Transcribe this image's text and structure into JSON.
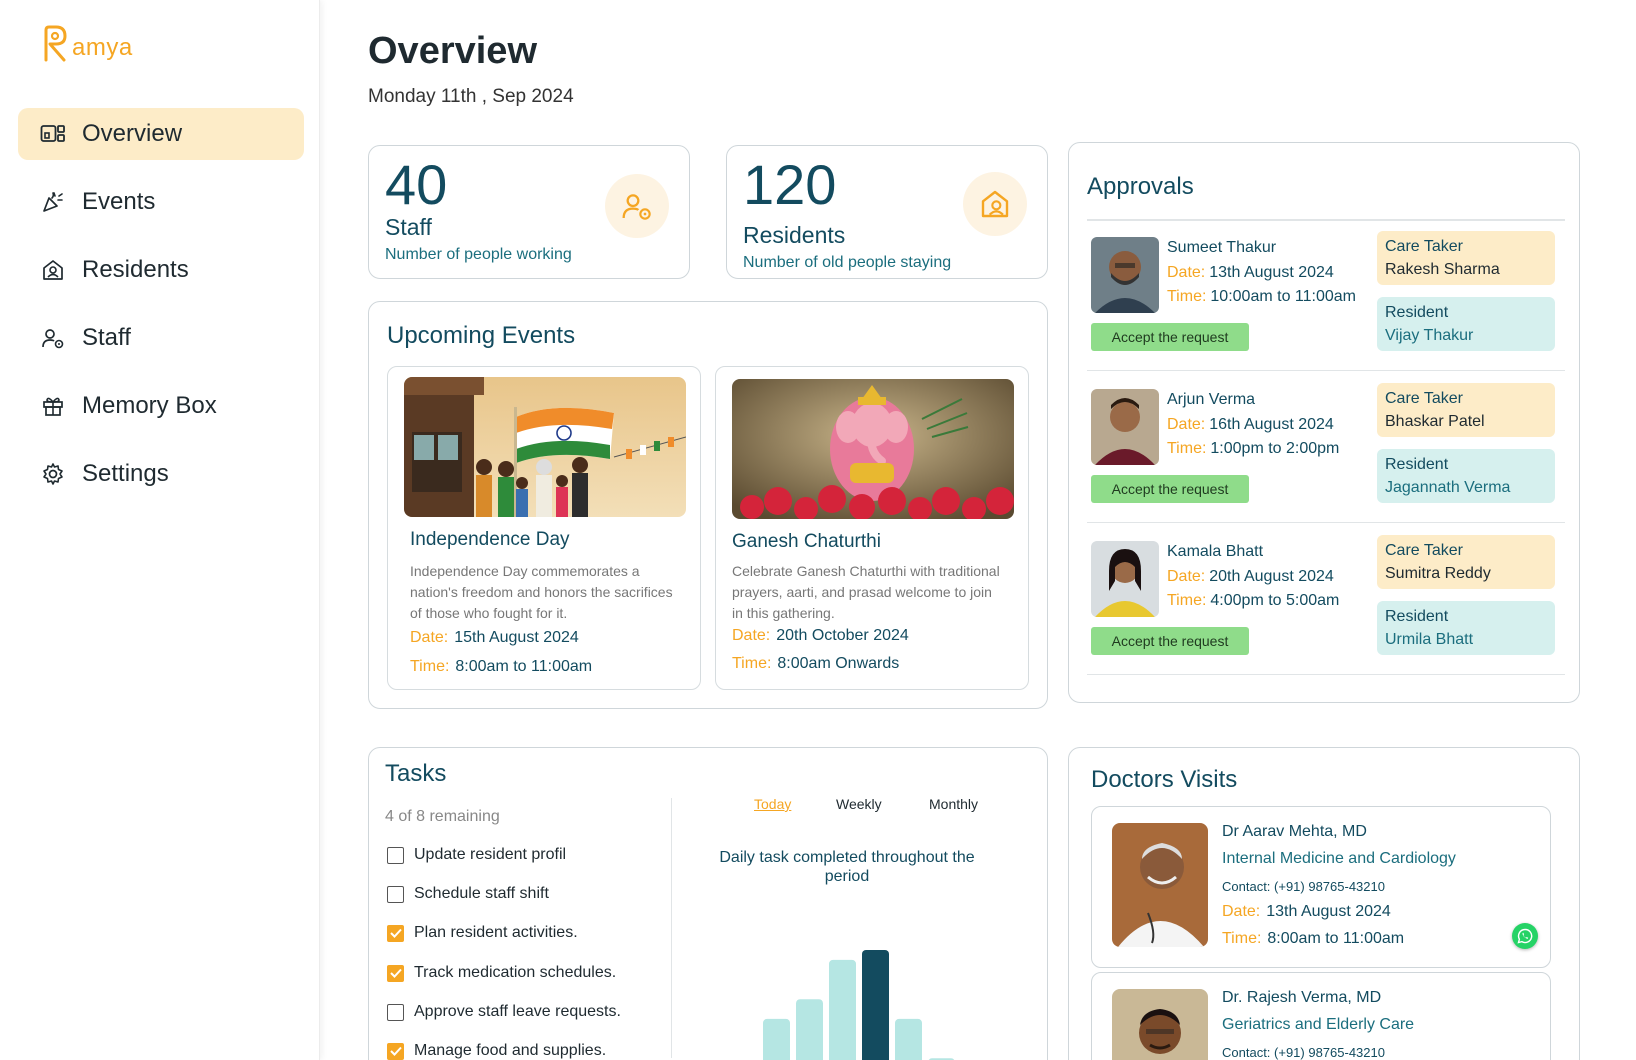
{
  "app": {
    "brand": "amya",
    "brand_initial": "R"
  },
  "sidebar": {
    "items": [
      {
        "label": "Overview",
        "icon": "dashboard-icon"
      },
      {
        "label": "Events",
        "icon": "party-popper-icon"
      },
      {
        "label": "Residents",
        "icon": "home-person-icon"
      },
      {
        "label": "Staff",
        "icon": "staff-icon"
      },
      {
        "label": "Memory Box",
        "icon": "gift-icon"
      },
      {
        "label": "Settings",
        "icon": "gear-icon"
      }
    ],
    "active": "Overview"
  },
  "header": {
    "title": "Overview",
    "date": "Monday 11th , Sep 2024"
  },
  "stats": {
    "staff": {
      "value": "40",
      "label": "Staff",
      "sub": "Number of people working",
      "icon": "staff-icon"
    },
    "residents": {
      "value": "120",
      "label": "Residents",
      "sub": "Number of old people staying",
      "icon": "home-person-icon"
    }
  },
  "events": {
    "title": "Upcoming Events",
    "date_key": "Date:",
    "time_key": "Time:",
    "items": [
      {
        "title": "Independence Day",
        "desc": "Independence Day commemorates a nation's freedom and honors the sacrifices of those who fought for it.",
        "date": "15th August 2024",
        "time": "8:00am to 11:00am"
      },
      {
        "title": "Ganesh Chaturthi",
        "desc": "Celebrate Ganesh Chaturthi with traditional prayers, aarti, and prasad welcome to join in this gathering.",
        "date": "20th October 2024",
        "time": "8:00am Onwards"
      }
    ]
  },
  "approvals": {
    "title": "Approvals",
    "date_key": "Date:",
    "time_key": "Time:",
    "accept_label": "Accept the request",
    "care_title": "Care Taker",
    "resident_title": "Resident",
    "items": [
      {
        "name": "Sumeet Thakur",
        "date": "13th August 2024",
        "time": "10:00am to 11:00am",
        "care_taker": "Rakesh Sharma",
        "resident": "Vijay Thakur"
      },
      {
        "name": "Arjun Verma",
        "date": "16th August 2024",
        "time": "1:00pm to 2:00pm",
        "care_taker": "Bhaskar Patel",
        "resident": "Jagannath Verma"
      },
      {
        "name": "Kamala Bhatt",
        "date": "20th August 2024",
        "time": "4:00pm to 5:00am",
        "care_taker": "Sumitra Reddy",
        "resident": "Urmila Bhatt"
      }
    ]
  },
  "tasks": {
    "title": "Tasks",
    "remaining": "4 of 8 remaining",
    "items": [
      {
        "label": "Update resident profil",
        "done": false
      },
      {
        "label": "Schedule staff shift",
        "done": false
      },
      {
        "label": "Plan resident activities.",
        "done": true
      },
      {
        "label": "Track medication schedules.",
        "done": true
      },
      {
        "label": "Approve staff leave requests.",
        "done": false
      },
      {
        "label": "Manage food and supplies.",
        "done": true
      }
    ],
    "tabs": [
      "Today",
      "Weekly",
      "Monthly"
    ],
    "active_tab": "Today",
    "chart_title": "Daily task completed throughout the period"
  },
  "chart_data": {
    "type": "bar",
    "title": "Daily task completed throughout the period",
    "xlabel": "",
    "ylabel": "",
    "values": [
      1,
      1,
      6,
      8,
      12,
      13,
      6,
      2
    ],
    "highlight_index": 5,
    "colors": {
      "default": "#b5e6e3",
      "highlight": "#134b5f"
    },
    "grid": false
  },
  "doctors": {
    "title": "Doctors Visits",
    "date_key": "Date:",
    "time_key": "Time:",
    "items": [
      {
        "name": "Dr Aarav Mehta, MD",
        "spec": "Internal Medicine and Cardiology",
        "contact": "Contact: (+91) 98765-43210",
        "date": "13th August 2024",
        "time": "8:00am to 11:00am"
      },
      {
        "name": "Dr. Rajesh Verma, MD",
        "spec": "Geriatrics and Elderly Care",
        "contact": "Contact: (+91) 98765-43210",
        "date": "",
        "time": ""
      }
    ]
  },
  "colors": {
    "accent": "#f5a623",
    "primary": "#134b5f",
    "active_nav": "#fdecc8",
    "accept": "#8fdc8a"
  }
}
